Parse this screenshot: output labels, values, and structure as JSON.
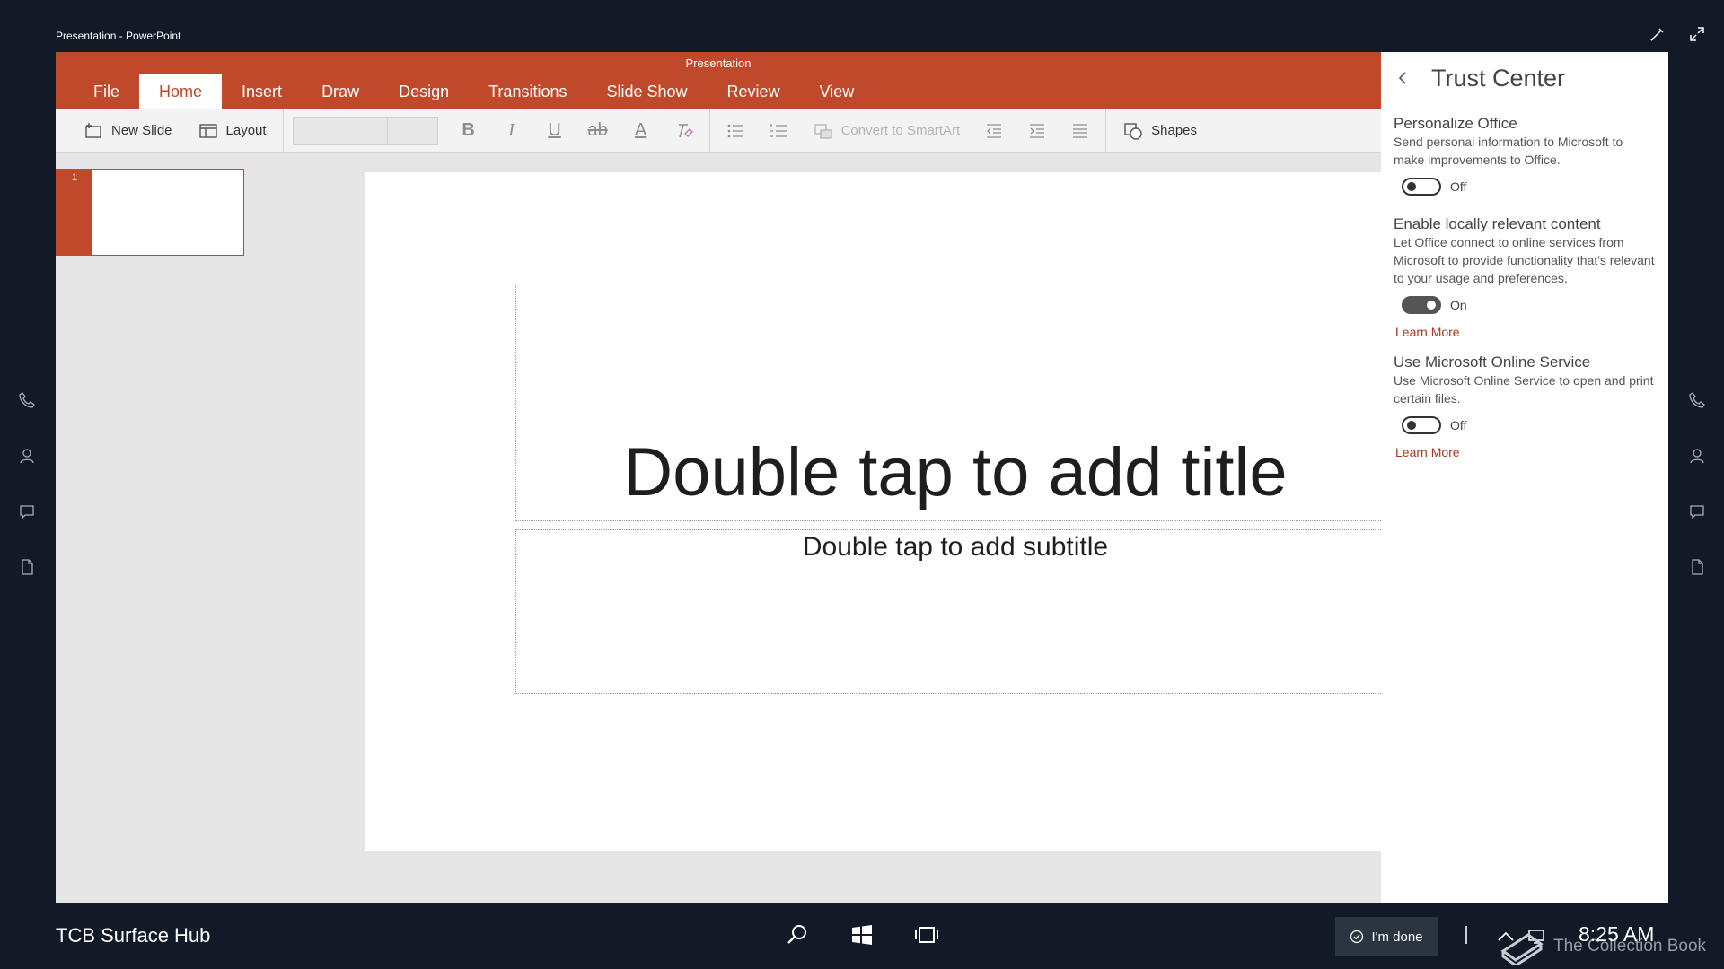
{
  "window": {
    "title": "Presentation - PowerPoint"
  },
  "ribbon": {
    "document_title": "Presentation",
    "tabs": [
      {
        "label": "File"
      },
      {
        "label": "Home",
        "active": true
      },
      {
        "label": "Insert"
      },
      {
        "label": "Draw"
      },
      {
        "label": "Design"
      },
      {
        "label": "Transitions"
      },
      {
        "label": "Slide Show"
      },
      {
        "label": "Review"
      },
      {
        "label": "View"
      }
    ],
    "toolbar": {
      "new_slide_label": "New Slide",
      "layout_label": "Layout",
      "font_name_value": "",
      "font_size_value": "",
      "smartart_label": "Convert to SmartArt",
      "shapes_label": "Shapes",
      "icons": [
        "new-slide-icon",
        "layout-icon",
        "bold-icon",
        "italic-icon",
        "underline-icon",
        "strikethrough-icon",
        "font-color-icon",
        "clear-formatting-icon",
        "bullets-icon",
        "numbering-icon",
        "smartart-icon",
        "decrease-indent-icon",
        "increase-indent-icon",
        "align-icon",
        "shapes-icon"
      ]
    }
  },
  "thumbnails": [
    {
      "number": "1"
    }
  ],
  "slide": {
    "title_placeholder": "Double tap to add title",
    "subtitle_placeholder": "Double tap to add subtitle"
  },
  "trust_center": {
    "title": "Trust Center",
    "sections": [
      {
        "title": "Personalize Office",
        "description": "Send personal information to Microsoft to make improvements to Office.",
        "toggle_state": "Off"
      },
      {
        "title": "Enable locally relevant content",
        "description": "Let Office connect to online services from Microsoft to provide functionality that's relevant to your usage and preferences.",
        "toggle_state": "On",
        "link": "Learn More"
      },
      {
        "title": "Use Microsoft Online Service",
        "description": "Use Microsoft Online Service to open and print certain files.",
        "toggle_state": "Off",
        "link": "Learn More"
      }
    ]
  },
  "rails": {
    "icons": [
      "phone-icon",
      "person-icon",
      "chat-icon",
      "document-icon"
    ]
  },
  "taskbar": {
    "device_name": "TCB Surface Hub",
    "done_label": "I'm done",
    "time": "8:25 AM",
    "watermark": "The Collection Book"
  },
  "colors": {
    "accent": "#c0482b",
    "background": "#121a28",
    "link": "#a8391f"
  }
}
